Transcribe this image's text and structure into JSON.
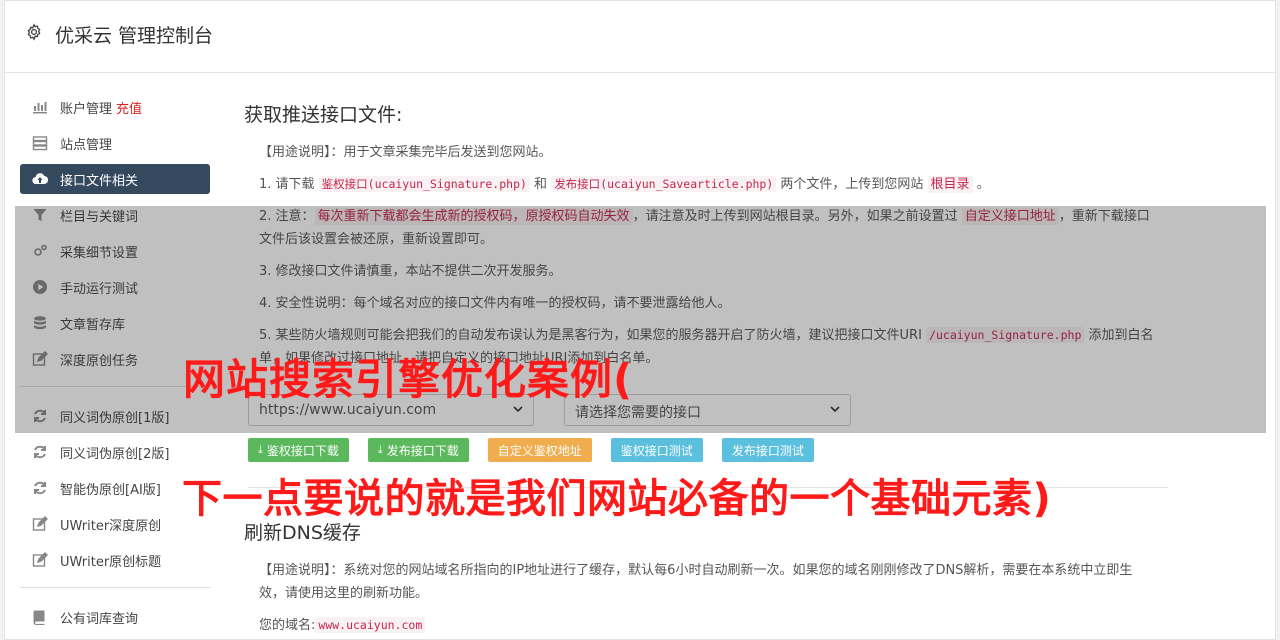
{
  "header": {
    "title": "优采云 管理控制台",
    "icon": "gear-icon"
  },
  "sidebar": {
    "items": [
      {
        "label": "账户管理",
        "extra": "充值",
        "icon": "bar-chart-icon"
      },
      {
        "label": "站点管理",
        "icon": "server-icon"
      },
      {
        "label": "接口文件相关",
        "icon": "cloud-upload-icon",
        "active": true
      },
      {
        "label": "栏目与关键词",
        "icon": "filter-icon"
      },
      {
        "label": "采集细节设置",
        "icon": "cogs-icon"
      },
      {
        "label": "手动运行测试",
        "icon": "play-circle-icon"
      },
      {
        "label": "文章暂存库",
        "icon": "database-icon"
      },
      {
        "label": "深度原创任务",
        "icon": "edit-icon"
      },
      {
        "label": "同义词伪原创[1版]",
        "icon": "refresh-icon"
      },
      {
        "label": "同义词伪原创[2版]",
        "icon": "refresh-icon"
      },
      {
        "label": "智能伪原创[AI版]",
        "icon": "refresh-icon"
      },
      {
        "label": "UWriter深度原创",
        "icon": "edit-icon"
      },
      {
        "label": "UWriter原创标题",
        "icon": "edit-icon"
      },
      {
        "label": "公有词库查询",
        "icon": "book-icon"
      }
    ]
  },
  "main": {
    "title": "获取推送接口文件:",
    "usage": "【用途说明】：用于文章采集完毕后发送到您网站。",
    "step1": {
      "pre": "1. 请下载 ",
      "link1": "鉴权接口",
      "code1": "(ucaiyun_Signature.php)",
      "mid": " 和 ",
      "link2": "发布接口",
      "code2": "(ucaiyun_Savearticle.php)",
      "post": " 两个文件，上传到您网站 ",
      "root": "根目录",
      "end": " 。"
    },
    "step2": {
      "pre": "2. 注意：",
      "warn": "每次重新下载都会生成新的授权码，原授权码自动失效",
      "mid": "，请注意及时上传到网站根目录。另外，如果之前设置过 ",
      "custom": "自定义接口地址",
      "post": "，重新下载接口文件后该设置会被还原，重新设置即可。"
    },
    "step3": "3. 修改接口文件请慎重，本站不提供二次开发服务。",
    "step4": "4. 安全性说明：每个域名对应的接口文件内有唯一的授权码，请不要泄露给他人。",
    "step5": {
      "pre": "5. 某些防火墙规则可能会把我们的自动发布误认为是黑客行为，如果您的服务器开启了防火墙，建议把接口文件URI ",
      "code": "/ucaiyun_Signature.php",
      "post": " 添加到白名单，如果修改过接口地址，请把自定义的接口地址URI添加到白名单。"
    },
    "site_select": "https://www.ucaiyun.com",
    "api_select": "请选择您需要的接口",
    "buttons": {
      "download_auth": "鉴权接口下载",
      "download_publish": "发布接口下载",
      "custom_auth": "自定义鉴权地址",
      "test_auth": "鉴权接口测试",
      "test_publish": "发布接口测试"
    }
  },
  "dns": {
    "title": "刷新DNS缓存",
    "usage": "【用途说明】：系统对您的网站域名所指向的IP地址进行了缓存，默认每6小时自动刷新一次。如果您的域名刚刚修改了DNS解析，需要在本系统中立即生效，请使用这里的刷新功能。",
    "domain_label": "您的域名:",
    "domain_value": "www.ucaiyun.com"
  },
  "overlay": {
    "line1": "网站搜索引擎优化案例(",
    "line2": "下一点要说的就是我们网站必备的一个基础元素)"
  },
  "colors": {
    "active_bg": "#34495e",
    "green": "#5cb85c",
    "orange": "#f0ad4e",
    "blue": "#5bc0de",
    "overlay_text": "#ff1a1a"
  }
}
